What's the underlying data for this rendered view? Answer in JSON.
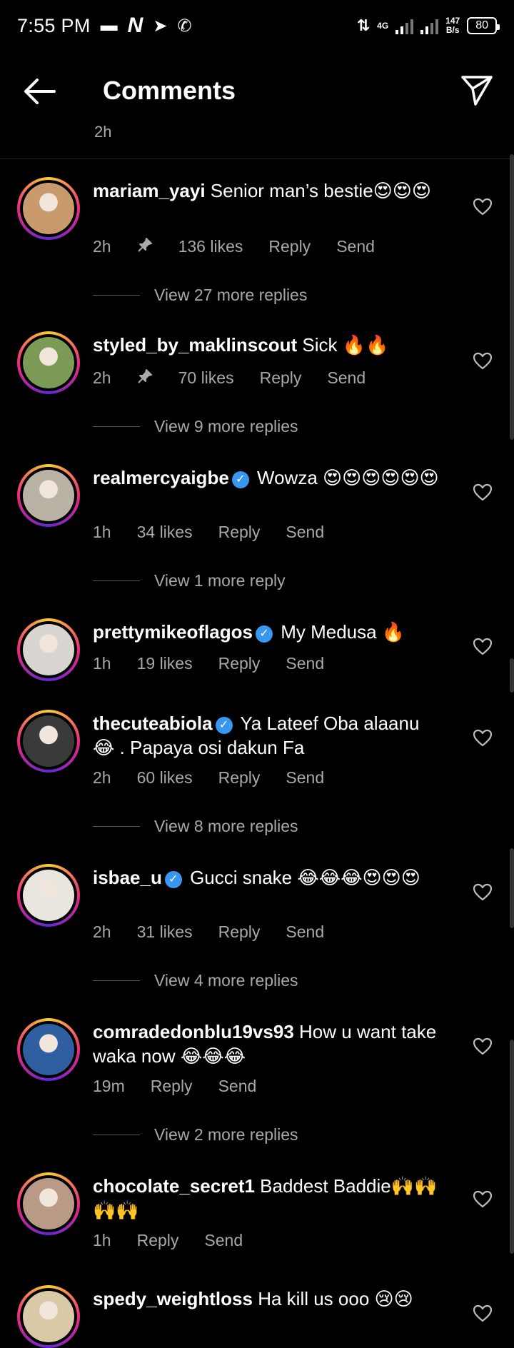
{
  "status_bar": {
    "time": "7:55 PM",
    "net_speed_value": "147",
    "net_speed_unit": "B/s",
    "battery": "80",
    "network_type": "4G"
  },
  "header": {
    "title": "Comments"
  },
  "prev_tail": "2h",
  "comments": [
    {
      "username": "mariam_yayi",
      "verified": false,
      "text": "Senior man’s bestie😍😍😍",
      "time": "2h",
      "pinned": true,
      "likes": "136 likes",
      "reply": "Reply",
      "send": "Send",
      "view_more": "View 27 more replies",
      "avatar_color": "#c99a6b"
    },
    {
      "username": "styled_by_maklinscout",
      "verified": false,
      "text": "Sick 🔥🔥",
      "time": "2h",
      "pinned": true,
      "likes": "70 likes",
      "reply": "Reply",
      "send": "Send",
      "view_more": "View 9 more replies",
      "avatar_color": "#7a9a55"
    },
    {
      "username": "realmercyaigbe",
      "verified": true,
      "text": "Wowza 😍😍😍😍😍😍",
      "time": "1h",
      "pinned": false,
      "likes": "34 likes",
      "reply": "Reply",
      "send": "Send",
      "view_more": "View 1 more reply",
      "avatar_color": "#b9b3a6"
    },
    {
      "username": "prettymikeoflagos",
      "verified": true,
      "text": "My Medusa 🔥",
      "time": "1h",
      "pinned": false,
      "likes": "19 likes",
      "reply": "Reply",
      "send": "Send",
      "view_more": "",
      "avatar_color": "#d8d4cf"
    },
    {
      "username": "thecuteabiola",
      "verified": true,
      "text": "Ya Lateef Oba alaanu 😂 . Papaya osi dakun Fa",
      "time": "2h",
      "pinned": false,
      "likes": "60 likes",
      "reply": "Reply",
      "send": "Send",
      "view_more": "View 8 more replies",
      "avatar_color": "#3a3a3a"
    },
    {
      "username": "isbae_u",
      "verified": true,
      "text": "Gucci snake 😂😂😂😍😍😍",
      "time": "2h",
      "pinned": false,
      "likes": "31 likes",
      "reply": "Reply",
      "send": "Send",
      "view_more": "View 4 more replies",
      "avatar_color": "#e9e6df"
    },
    {
      "username": "comradedonblu19vs93",
      "verified": false,
      "text": "How u want take waka now 😂😂😂",
      "time": "19m",
      "pinned": false,
      "likes": "",
      "reply": "Reply",
      "send": "Send",
      "view_more": "View 2 more replies",
      "avatar_color": "#2f5fa0"
    },
    {
      "username": "chocolate_secret1",
      "verified": false,
      "text": "Baddest Baddie🙌🙌🙌🙌",
      "time": "1h",
      "pinned": false,
      "likes": "",
      "reply": "Reply",
      "send": "Send",
      "view_more": "",
      "avatar_color": "#b89a86"
    },
    {
      "username": "spedy_weightloss",
      "verified": false,
      "text": "Ha kill us ooo 😢😢",
      "time": "",
      "pinned": false,
      "likes": "",
      "reply": "",
      "send": "",
      "view_more": "",
      "avatar_color": "#d9c9a6"
    }
  ]
}
